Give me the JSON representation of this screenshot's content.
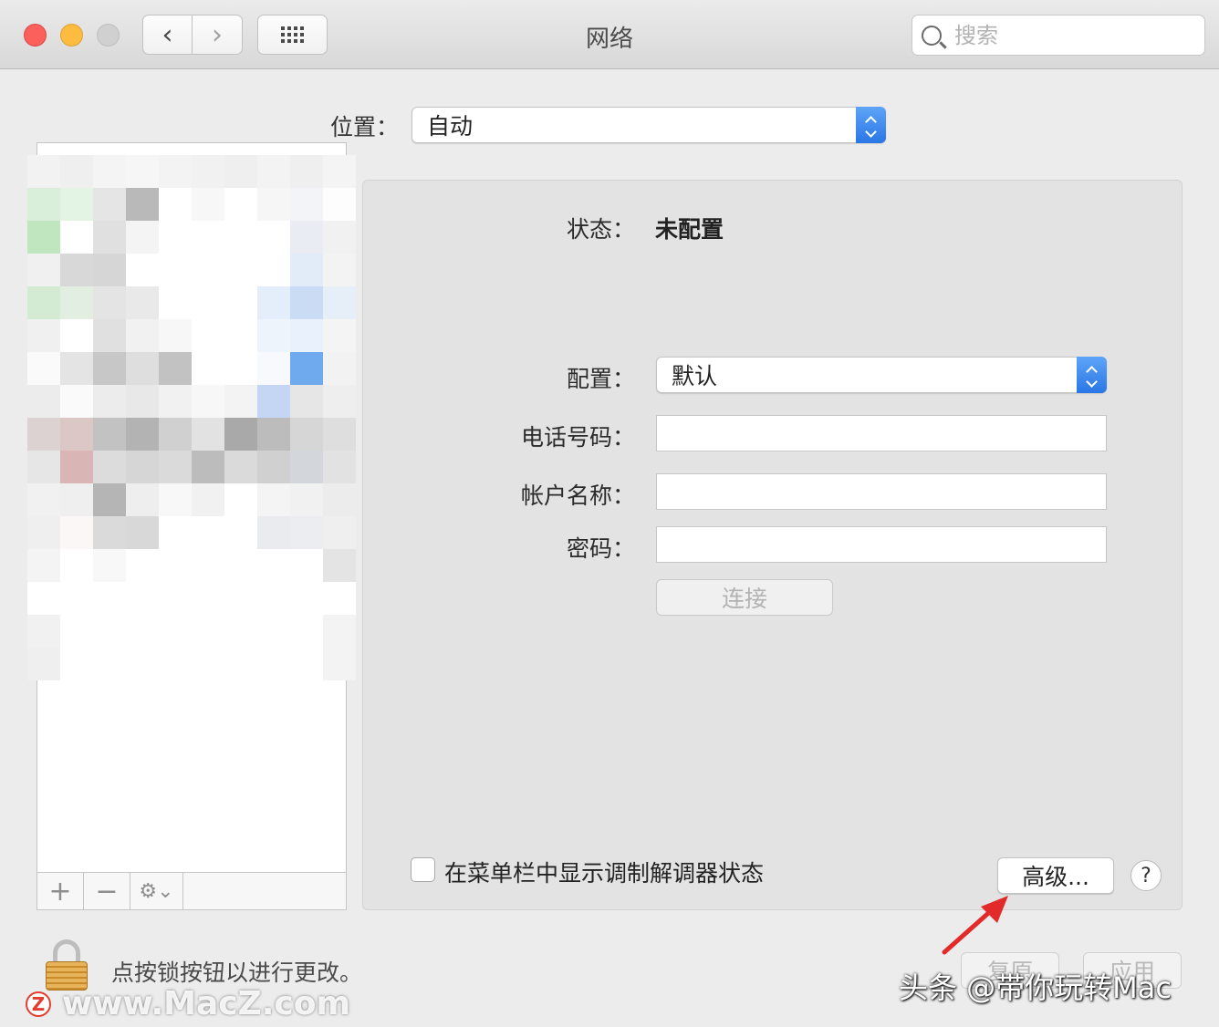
{
  "window": {
    "title": "网络"
  },
  "toolbar": {
    "back": "‹",
    "forward": "›",
    "search_placeholder": "搜索"
  },
  "location": {
    "label": "位置：",
    "value": "自动"
  },
  "panel": {
    "status_label": "状态：",
    "status_value": "未配置",
    "config_label": "配置：",
    "config_value": "默认",
    "phone_label": "电话号码：",
    "phone_value": "",
    "account_label": "帐户名称：",
    "account_value": "",
    "password_label": "密码：",
    "password_value": "",
    "connect_label": "连接",
    "show_modem_status": "在菜单栏中显示调制解调器状态",
    "advanced_label": "高级...",
    "help_label": "?"
  },
  "sidebar_footer": {
    "add": "+",
    "remove": "−",
    "gear": "⚙⌄"
  },
  "bottom": {
    "lock_text": "点按锁按钮以进行更改。",
    "revert_label": "复原",
    "apply_label": "应用"
  },
  "watermarks": {
    "left_badge": "Z",
    "left_text": "www.MacZ.com",
    "right_text": "头条 @带你玩转Mac"
  },
  "colors": {
    "accent": "#2a77e6",
    "arrow": "#e32a2a"
  }
}
